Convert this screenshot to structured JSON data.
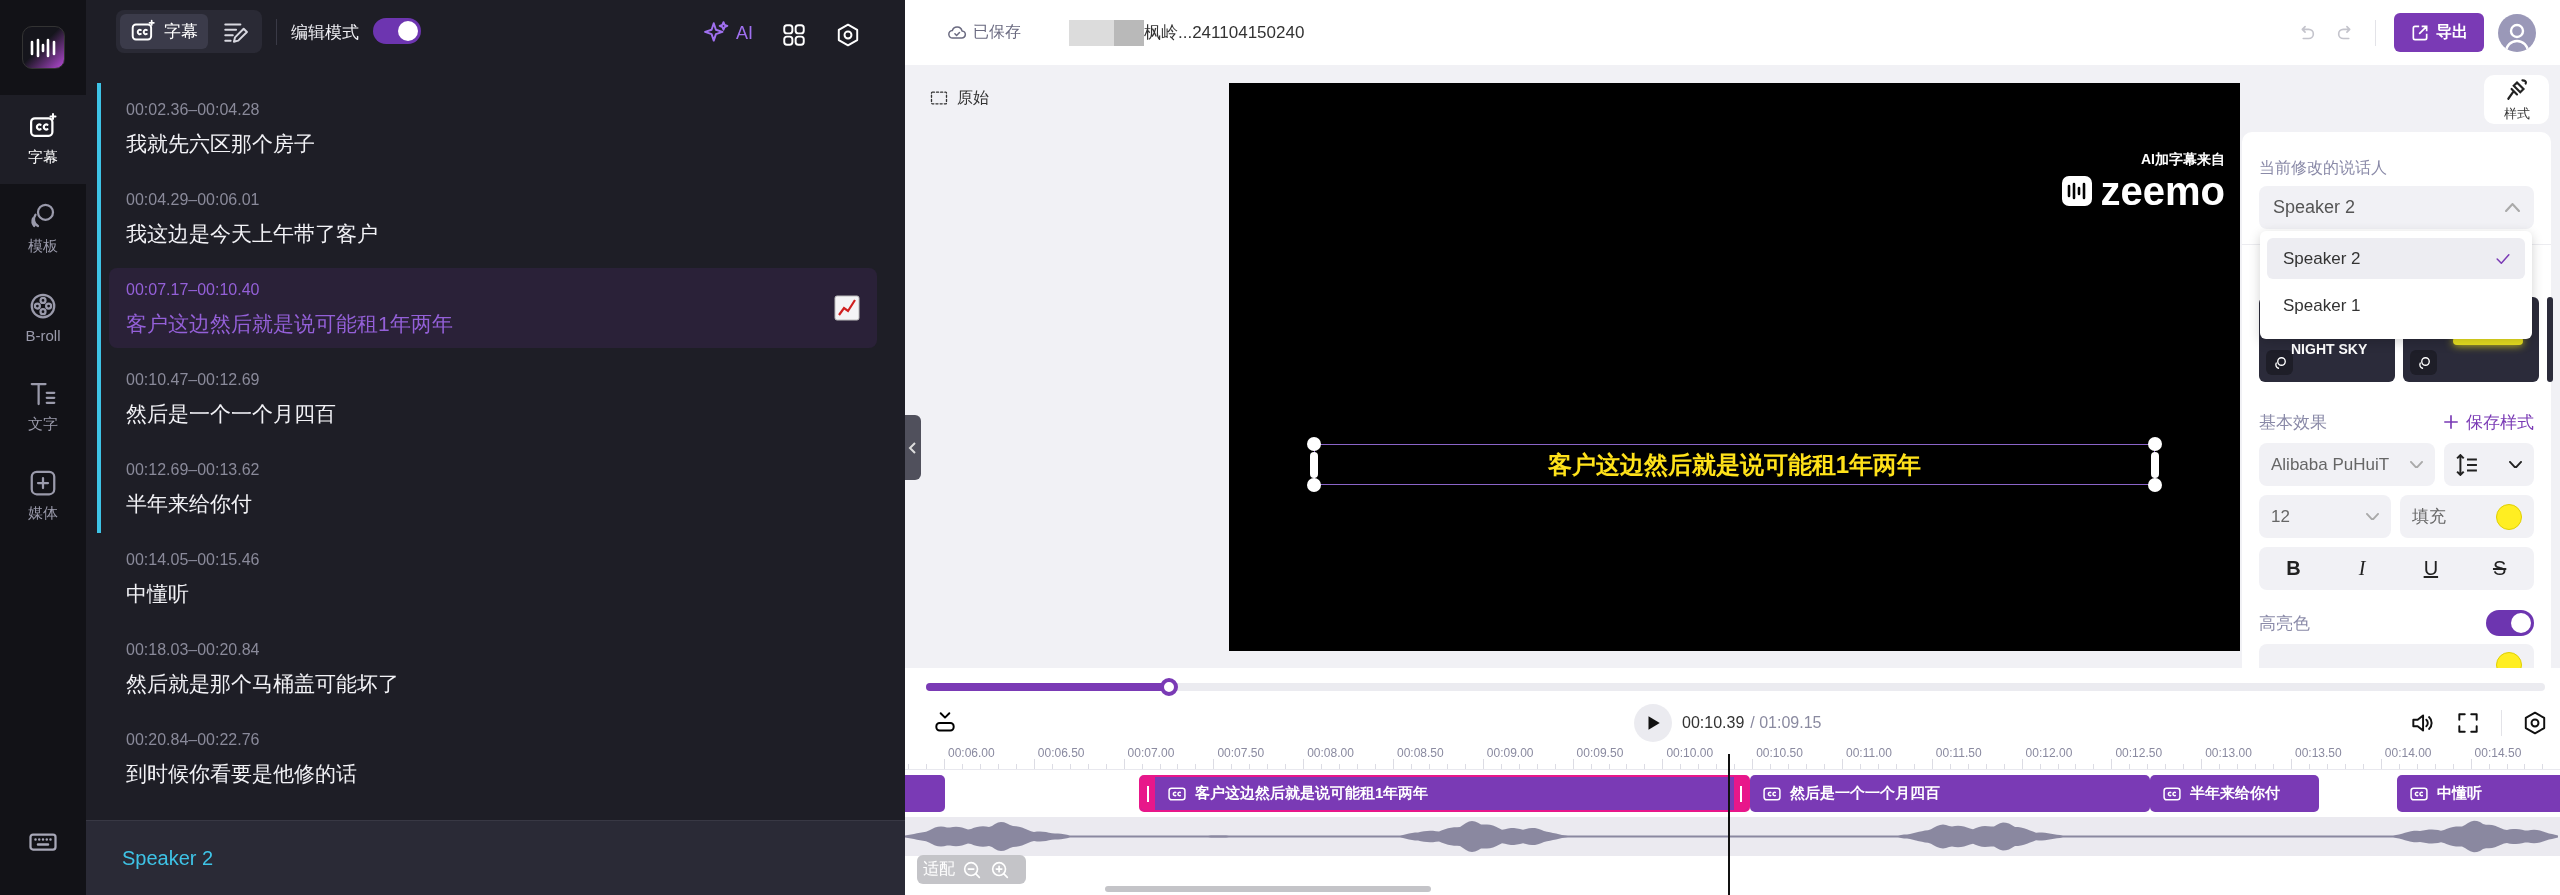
{
  "nav": {
    "items": [
      {
        "kind": "captions",
        "label": "字幕",
        "selected": true
      },
      {
        "kind": "template",
        "label": "模板",
        "selected": false
      },
      {
        "kind": "broll",
        "label": "B-roll",
        "selected": false
      },
      {
        "kind": "text",
        "label": "文字",
        "selected": false
      },
      {
        "kind": "media",
        "label": "媒体",
        "selected": false
      }
    ]
  },
  "subtitle_header": {
    "tabs": [
      {
        "kind": "captions",
        "label": "字幕",
        "selected": true
      },
      {
        "kind": "edit",
        "selected": false
      }
    ],
    "edit_mode": {
      "label": "编辑模式",
      "on": true
    },
    "ai_label": "AI"
  },
  "subtitles": [
    {
      "time": "00:02.36–00:04.28",
      "text": "我就先六区那个房子",
      "selected": false,
      "current_speaker": true
    },
    {
      "time": "00:04.29–00:06.01",
      "text": "我这边是今天上午带了客户",
      "selected": false,
      "current_speaker": true
    },
    {
      "time": "00:07.17–00:10.40",
      "text": "客户这边然后就是说可能租1年两年",
      "selected": true,
      "current_speaker": true
    },
    {
      "time": "00:10.47–00:12.69",
      "text": "然后是一个一个月四百",
      "selected": false,
      "current_speaker": true
    },
    {
      "time": "00:12.69–00:13.62",
      "text": "半年来给你付",
      "selected": false,
      "current_speaker": true
    },
    {
      "time": "00:14.05–00:15.46",
      "text": "中懂听",
      "selected": false,
      "current_speaker": false
    },
    {
      "time": "00:18.03–00:20.84",
      "text": "然后就是那个马桶盖可能坏了",
      "selected": false,
      "current_speaker": false
    },
    {
      "time": "00:20.84–00:22.76",
      "text": "到时候你看要是他修的话",
      "selected": false,
      "current_speaker": false
    }
  ],
  "speaker_bar": {
    "name": "Speaker 2"
  },
  "top_bar": {
    "save_status": "已保存",
    "file_name": "枫岭...241104150240",
    "undo_disabled": true,
    "redo_disabled": true,
    "export_label": "导出"
  },
  "preview": {
    "original_label": "原始",
    "watermark": {
      "caption": "AI加字幕来自",
      "brand": "zeemo"
    },
    "subtitle": "客户这边然后就是说可能租1年两年"
  },
  "style_panel": {
    "button_label": "样式",
    "speaker_label": "当前修改的说话人",
    "speaker_select": {
      "value": "Speaker 2",
      "expanded": true
    },
    "speaker_options": [
      {
        "label": "Speaker 2",
        "selected": true
      },
      {
        "label": "Speaker 1",
        "selected": false
      }
    ],
    "templates": [
      {
        "kind": "labeled",
        "label": "NIGHT SKY"
      },
      {
        "kind": "glow"
      }
    ],
    "basic_effects": {
      "title": "基本效果",
      "save_style": "保存样式",
      "font": "Alibaba PuHuiT",
      "size": "12",
      "fill_label": "填充",
      "format_buttons": [
        {
          "kind": "bold",
          "label": "B"
        },
        {
          "kind": "italic",
          "label": "I"
        },
        {
          "kind": "underline",
          "label": "U"
        },
        {
          "kind": "strike",
          "label": "S"
        }
      ]
    },
    "highlight": {
      "label": "高亮色",
      "on": true
    }
  },
  "player": {
    "level": 0.15,
    "current": "00:10.39",
    "total": "/ 01:09.15"
  },
  "timeline": {
    "ruler_labels": [
      "00:06.00",
      "00:06.50",
      "00:07.00",
      "00:07.50",
      "00:08.00",
      "00:08.50",
      "00:09.00",
      "00:09.50",
      "00:10.00",
      "00:10.50",
      "00:11.00",
      "00:11.50",
      "00:12.00",
      "00:12.50",
      "00:13.00",
      "00:13.50",
      "00:14.00",
      "00:14.50"
    ],
    "clips": [
      {
        "selected": false
      },
      {
        "text": "客户这边然后就是说可能租1年两年",
        "selected": true
      },
      {
        "text": "然后是一个一个月四百",
        "selected": false
      },
      {
        "text": "半年来给你付",
        "selected": false
      },
      {
        "text": "中懂听",
        "selected": false
      }
    ],
    "fit_label": "适配"
  }
}
